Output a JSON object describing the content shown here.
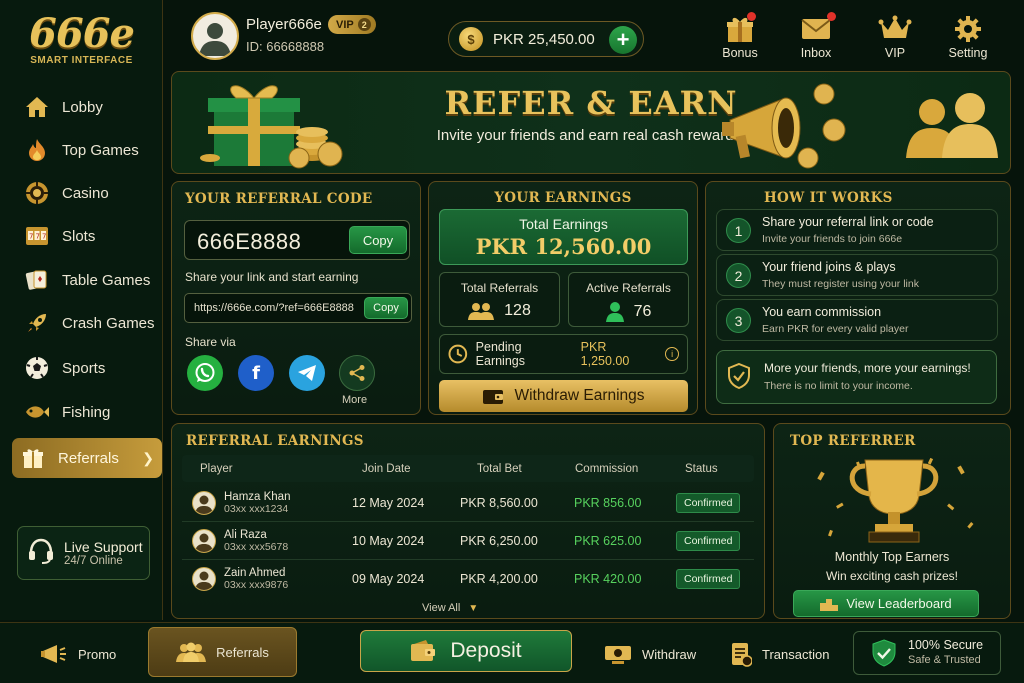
{
  "brand": {
    "name": "666e",
    "tagline": "SMART INTERFACE"
  },
  "sidebar": {
    "items": [
      {
        "label": "Lobby",
        "icon": "home-icon"
      },
      {
        "label": "Top Games",
        "icon": "fire-icon"
      },
      {
        "label": "Casino",
        "icon": "casino-chip-icon"
      },
      {
        "label": "Slots",
        "icon": "slot-machine-icon"
      },
      {
        "label": "Table Games",
        "icon": "cards-icon"
      },
      {
        "label": "Crash Games",
        "icon": "rocket-icon"
      },
      {
        "label": "Sports",
        "icon": "soccer-ball-icon"
      },
      {
        "label": "Fishing",
        "icon": "fish-icon"
      },
      {
        "label": "Referrals",
        "icon": "gift-icon",
        "active": true
      }
    ],
    "support": {
      "title": "Live Support",
      "subtitle": "24/7 Online"
    }
  },
  "user": {
    "name": "Player666e",
    "vip_label": "VIP",
    "vip_level": "2",
    "id_text": "ID: 66668888"
  },
  "balance": {
    "amount": "PKR 25,450.00"
  },
  "topbar": {
    "items": [
      {
        "label": "Bonus",
        "icon": "gift-icon",
        "notify": true
      },
      {
        "label": "Inbox",
        "icon": "mail-icon",
        "notify": true
      },
      {
        "label": "VIP",
        "icon": "crown-icon",
        "notify": false
      },
      {
        "label": "Setting",
        "icon": "gear-icon",
        "notify": false
      }
    ]
  },
  "banner": {
    "title": "REFER & EARN",
    "subtitle": "Invite your friends and earn real cash rewards!"
  },
  "referral_code": {
    "title": "YOUR REFERRAL CODE",
    "code": "666E8888",
    "copy_label": "Copy",
    "share_link_label": "Share your link and start earning",
    "link": "https://666e.com/?ref=666E8888",
    "link_copy_label": "Copy",
    "share_via_label": "Share via",
    "more_label": "More"
  },
  "earnings": {
    "title": "YOUR EARNINGS",
    "total_label": "Total Earnings",
    "total_value": "PKR 12,560.00",
    "total_referrals_label": "Total Referrals",
    "total_referrals_value": "128",
    "active_referrals_label": "Active Referrals",
    "active_referrals_value": "76",
    "pending_label": "Pending Earnings",
    "pending_value": "PKR 1,250.00",
    "withdraw_label": "Withdraw Earnings"
  },
  "how_it_works": {
    "title": "HOW IT WORKS",
    "steps": [
      {
        "num": "1",
        "title": "Share your referral link or code",
        "desc": "Invite your friends to join 666e"
      },
      {
        "num": "2",
        "title": "Your friend joins & plays",
        "desc": "They must register using your link"
      },
      {
        "num": "3",
        "title": "You earn commission",
        "desc": "Earn PKR for every valid player"
      }
    ],
    "more_title": "More your friends, more your earnings!",
    "more_desc": "There is no limit to your income."
  },
  "referral_earnings": {
    "title": "REFERRAL EARNINGS",
    "columns": [
      "Player",
      "Join Date",
      "Total Bet",
      "Commission",
      "Status"
    ],
    "rows": [
      {
        "name": "Hamza Khan",
        "phone": "03xx xxx1234",
        "date": "12 May 2024",
        "bet": "PKR 8,560.00",
        "commission": "PKR 856.00",
        "status": "Confirmed"
      },
      {
        "name": "Ali Raza",
        "phone": "03xx xxx5678",
        "date": "10 May 2024",
        "bet": "PKR 6,250.00",
        "commission": "PKR 625.00",
        "status": "Confirmed"
      },
      {
        "name": "Zain Ahmed",
        "phone": "03xx xxx9876",
        "date": "09 May 2024",
        "bet": "PKR 4,200.00",
        "commission": "PKR 420.00",
        "status": "Confirmed"
      }
    ],
    "view_all_label": "View All"
  },
  "top_referrer": {
    "title": "TOP REFERRER",
    "subtitle1": "Monthly Top Earners",
    "subtitle2": "Win exciting cash prizes!",
    "button_label": "View Leaderboard"
  },
  "bottombar": {
    "promo": "Promo",
    "referrals": "Referrals",
    "deposit": "Deposit",
    "withdraw": "Withdraw",
    "transaction": "Transaction",
    "secure_title": "100% Secure",
    "secure_sub": "Safe & Trusted"
  },
  "colors": {
    "gold": "#e2b852",
    "green": "#1b7a36",
    "background": "#06140b",
    "commission": "#57d25e",
    "notify": "#e0322a"
  }
}
